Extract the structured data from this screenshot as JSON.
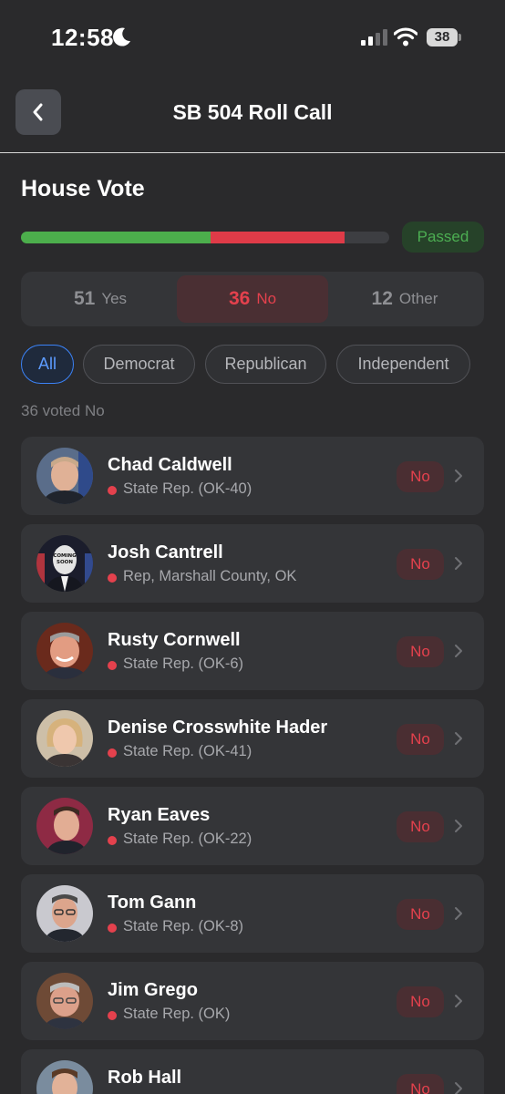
{
  "status": {
    "time": "12:58",
    "battery": "38"
  },
  "nav": {
    "title": "SB 504 Roll Call"
  },
  "section": {
    "title": "House Vote",
    "result": "Passed"
  },
  "results": {
    "yes": 51,
    "no": 36,
    "other": 12
  },
  "tally": [
    {
      "count": "51",
      "label": "Yes"
    },
    {
      "count": "36",
      "label": "No"
    },
    {
      "count": "12",
      "label": "Other"
    }
  ],
  "filters": [
    "All",
    "Democrat",
    "Republican",
    "Independent"
  ],
  "summary": "36 voted No",
  "colors": {
    "yes": "#4cae4c",
    "no": "#df3b48",
    "accent": "#3b82f6",
    "republican_dot": "#e4414d"
  },
  "members": [
    {
      "name": "Chad Caldwell",
      "role": "State Rep. (OK-40)",
      "vote": "No"
    },
    {
      "name": "Josh Cantrell",
      "role": "Rep, Marshall County, OK",
      "vote": "No",
      "avatar_text": "COMING SOON"
    },
    {
      "name": "Rusty Cornwell",
      "role": "State Rep. (OK-6)",
      "vote": "No"
    },
    {
      "name": "Denise Crosswhite Hader",
      "role": "State Rep. (OK-41)",
      "vote": "No"
    },
    {
      "name": "Ryan Eaves",
      "role": "State Rep. (OK-22)",
      "vote": "No"
    },
    {
      "name": "Tom Gann",
      "role": "State Rep. (OK-8)",
      "vote": "No"
    },
    {
      "name": "Jim Grego",
      "role": "State Rep. (OK)",
      "vote": "No"
    },
    {
      "name": "Rob Hall",
      "role": "",
      "vote": "No"
    }
  ]
}
